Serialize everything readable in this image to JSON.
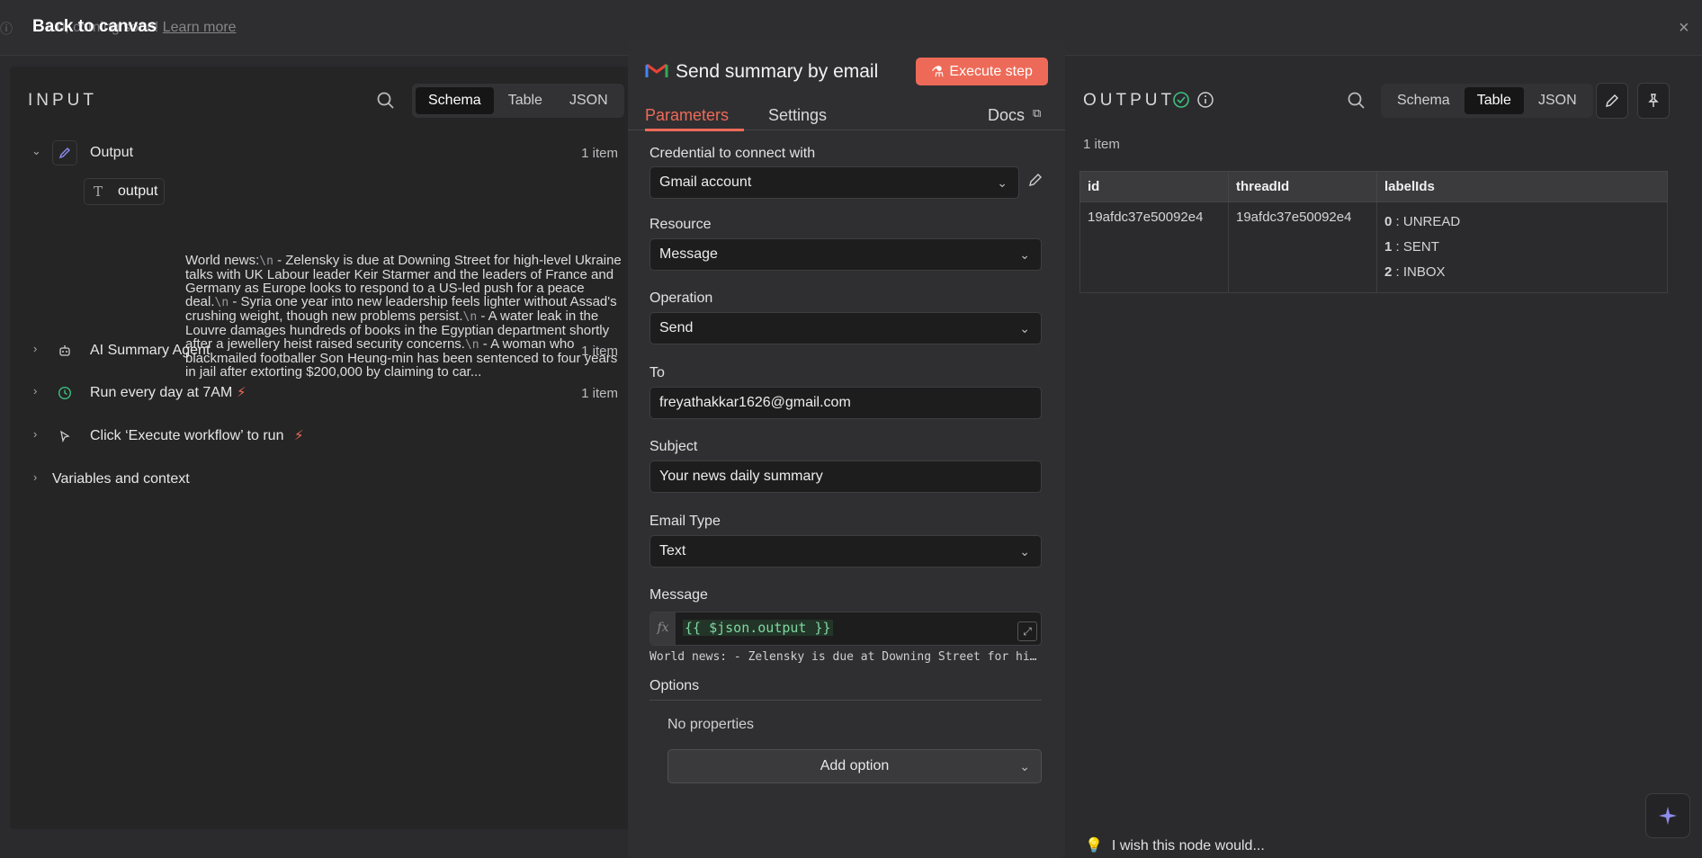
{
  "topbar": {
    "back_label": "Back to canvas",
    "banner_text": "2.0, coming soon!",
    "banner_link": "Learn more"
  },
  "input": {
    "title": "INPUT",
    "tabs": [
      "Schema",
      "Table",
      "JSON"
    ],
    "active_tab": "Schema",
    "rows": [
      {
        "label": "Output",
        "count": "1 item",
        "icon": "pencil-icon",
        "expanded": true
      },
      {
        "label": "AI Summary Agent",
        "count": "1 item",
        "icon": "robot-icon"
      },
      {
        "label": "Run every day at 7AM",
        "count": "1 item",
        "icon": "clock-icon",
        "trigger": true
      },
      {
        "label": "Click ‘Execute workflow’ to run",
        "count": "",
        "icon": "cursor-icon",
        "trigger": true
      },
      {
        "label": "Variables and context",
        "count": ""
      }
    ],
    "field_name": "output",
    "field_value_parts": [
      {
        "t": "World news:"
      },
      {
        "nl": "\\n"
      },
      {
        "t": " - Zelensky is due at Downing Street for high-level Ukraine talks with UK Labour leader Keir Starmer and the leaders of France and Germany as Europe looks to respond to a US-led push for a peace deal."
      },
      {
        "nl": "\\n"
      },
      {
        "t": " - Syria one year into new leadership feels lighter without Assad's crushing weight, though new problems persist."
      },
      {
        "nl": "\\n"
      },
      {
        "t": " - A water leak in the Louvre damages hundreds of books in the Egyptian department shortly after a jewellery heist raised security concerns."
      },
      {
        "nl": "\\n"
      },
      {
        "t": " - A woman who blackmailed footballer Son Heung-min has been sentenced to four years in jail after extorting $200,000 by claiming to car..."
      }
    ]
  },
  "node": {
    "title": "Send summary by email",
    "execute_label": "Execute step",
    "tabs": {
      "parameters": "Parameters",
      "settings": "Settings",
      "docs": "Docs"
    },
    "credential_label": "Credential to connect with",
    "credential_value": "Gmail account",
    "resource_label": "Resource",
    "resource_value": "Message",
    "operation_label": "Operation",
    "operation_value": "Send",
    "to_label": "To",
    "to_value": "freyathakkar1626@gmail.com",
    "subject_label": "Subject",
    "subject_value": "Your news daily summary",
    "email_type_label": "Email Type",
    "email_type_value": "Text",
    "message_label": "Message",
    "message_fx": "fx",
    "message_expr": "{{ $json.output }}",
    "message_preview": "World news: - Zelensky is due at Downing Street for high-level Ukraine talks with UK Labour leader",
    "options_label": "Options",
    "no_properties": "No properties",
    "add_option": "Add option",
    "accent": "#ee6a58"
  },
  "output": {
    "title": "OUTPUT",
    "tabs": [
      "Schema",
      "Table",
      "JSON"
    ],
    "active_tab": "Table",
    "item_count": "1 item",
    "columns": [
      "id",
      "threadId",
      "labelIds"
    ],
    "row": {
      "id": "19afdc37e50092e4",
      "threadId": "19afdc37e50092e4",
      "labels": [
        {
          "k": "0",
          "v": "UNREAD"
        },
        {
          "k": "1",
          "v": "SENT"
        },
        {
          "k": "2",
          "v": "INBOX"
        }
      ]
    }
  },
  "footer": {
    "wish": "I wish this node would..."
  }
}
